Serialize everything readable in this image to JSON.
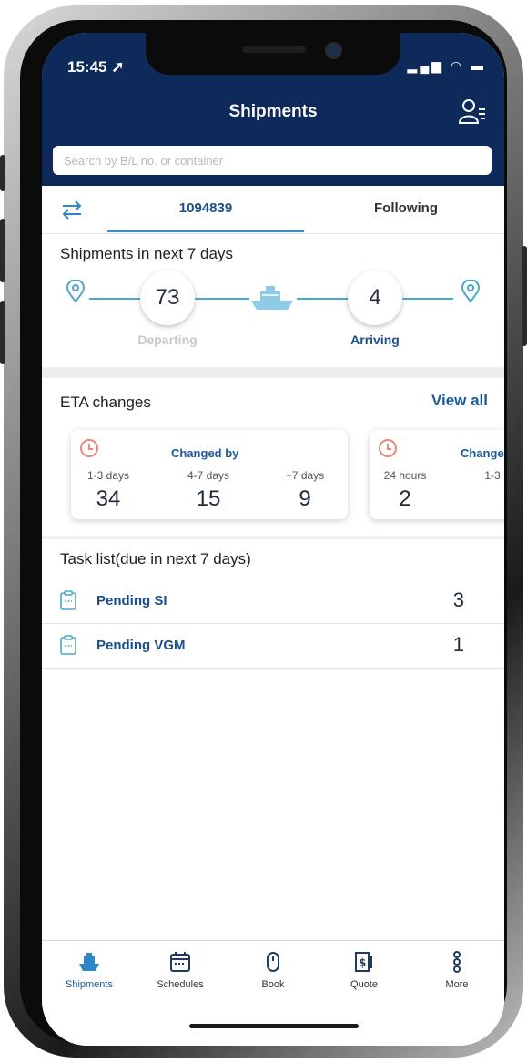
{
  "status_bar": {
    "time": "15:45 ➚",
    "icons": "▂▄▆ ◠ ▬"
  },
  "header": {
    "title": "Shipments"
  },
  "search": {
    "placeholder": "Search by B/L no. or container"
  },
  "tabs": {
    "active": "1094839",
    "following": "Following"
  },
  "shipments_next": {
    "title": "Shipments in next 7 days",
    "departing": {
      "count": "73",
      "label": "Departing"
    },
    "arriving": {
      "count": "4",
      "label": "Arriving"
    }
  },
  "eta": {
    "title": "ETA changes",
    "view_all": "View all",
    "cards": [
      {
        "heading": "Changed by",
        "buckets": [
          {
            "label": "1-3 days",
            "value": "34"
          },
          {
            "label": "4-7 days",
            "value": "15"
          },
          {
            "label": "+7 days",
            "value": "9"
          }
        ]
      },
      {
        "heading": "Change",
        "buckets": [
          {
            "label": "24 hours",
            "value": "2"
          },
          {
            "label": "1-3",
            "value": ""
          }
        ]
      }
    ]
  },
  "tasks": {
    "title": "Task list(due in next 7 days)",
    "items": [
      {
        "label": "Pending SI",
        "count": "3"
      },
      {
        "label": "Pending VGM",
        "count": "1"
      }
    ]
  },
  "nav": {
    "items": [
      {
        "label": "Shipments",
        "icon": "ship-icon"
      },
      {
        "label": "Schedules",
        "icon": "calendar-icon"
      },
      {
        "label": "Book",
        "icon": "mouse-icon"
      },
      {
        "label": "Quote",
        "icon": "quote-icon"
      },
      {
        "label": "More",
        "icon": "more-icon"
      }
    ]
  },
  "colors": {
    "header": "#0d2a5a",
    "accent": "#1b5a96",
    "route": "#4aa8d0",
    "clock": "#e88a7a"
  }
}
